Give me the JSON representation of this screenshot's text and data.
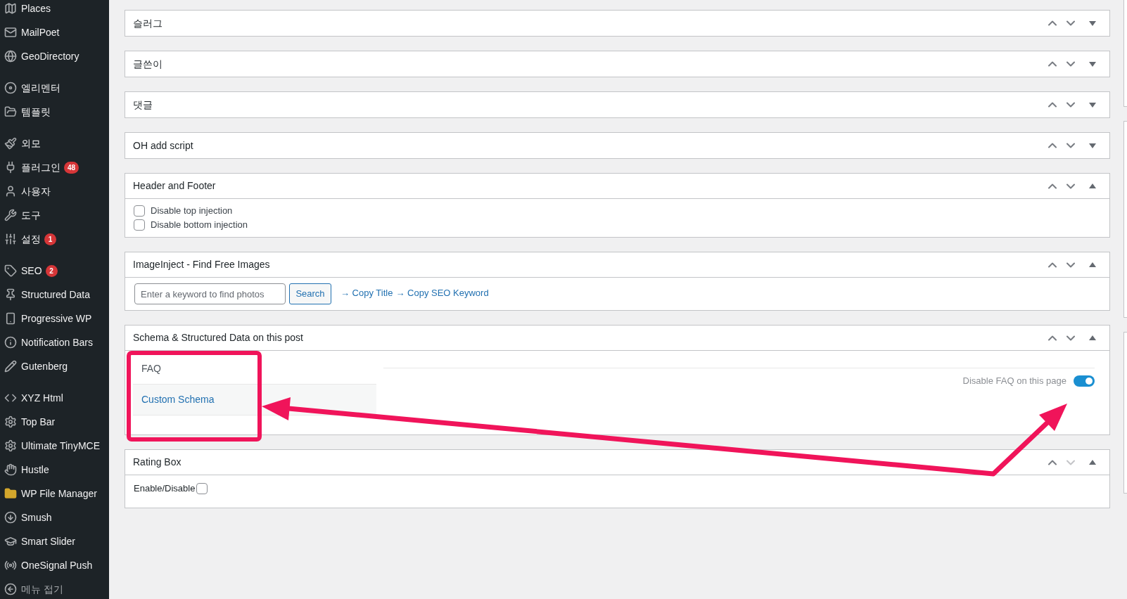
{
  "sidebar": {
    "groups": [
      {
        "items": [
          {
            "label": "Places"
          },
          {
            "label": "MailPoet"
          },
          {
            "label": "GeoDirectory"
          }
        ]
      },
      {
        "items": [
          {
            "label": "엘리멘터"
          },
          {
            "label": "템플릿"
          }
        ]
      },
      {
        "items": [
          {
            "label": "외모"
          },
          {
            "label": "플러그인",
            "badge": "48"
          },
          {
            "label": "사용자"
          },
          {
            "label": "도구"
          },
          {
            "label": "설정",
            "badge": "1"
          }
        ]
      },
      {
        "items": [
          {
            "label": "SEO",
            "badge": "2"
          },
          {
            "label": "Structured Data"
          },
          {
            "label": "Progressive WP"
          },
          {
            "label": "Notification Bars"
          },
          {
            "label": "Gutenberg"
          }
        ]
      },
      {
        "items": [
          {
            "label": "XYZ Html"
          },
          {
            "label": "Top Bar"
          },
          {
            "label": "Ultimate TinyMCE"
          },
          {
            "label": "Hustle"
          },
          {
            "label": "WP File Manager"
          },
          {
            "label": "Smush"
          },
          {
            "label": "Smart Slider"
          },
          {
            "label": "OneSignal Push"
          }
        ]
      }
    ],
    "collapse": {
      "label": "메뉴 접기"
    }
  },
  "panels": [
    {
      "title": "슬러그",
      "expanded": false,
      "move_down_disabled": false
    },
    {
      "title": "글쓴이",
      "expanded": false,
      "move_down_disabled": false
    },
    {
      "title": "댓글",
      "expanded": false,
      "move_down_disabled": false
    },
    {
      "title": "OH add script",
      "expanded": false,
      "move_down_disabled": false
    },
    {
      "title": "Header and Footer",
      "kind": "checkboxes",
      "expanded": true,
      "move_down_disabled": false,
      "checkboxes": [
        {
          "label": "Disable top injection",
          "checked": false
        },
        {
          "label": "Disable bottom injection",
          "checked": false
        }
      ]
    },
    {
      "title": "ImageInject - Find Free Images",
      "kind": "image_search",
      "expanded": true,
      "move_down_disabled": false,
      "search": {
        "placeholder": "Enter a keyword to find photos"
      },
      "button": "Search",
      "links": [
        "→ Copy Title",
        "→ Copy SEO Keyword"
      ]
    },
    {
      "title": "Schema & Structured Data on this post",
      "kind": "schema_tabs",
      "expanded": true,
      "move_down_disabled": false,
      "tabs": [
        {
          "label": "FAQ",
          "selected": true
        },
        {
          "label": "Custom Schema",
          "selected": false
        }
      ],
      "toggle": {
        "label": "Disable FAQ on this page",
        "on": true
      }
    },
    {
      "title": "Rating Box",
      "kind": "enable_checkbox",
      "expanded": true,
      "move_down_disabled": true,
      "checkbox": {
        "label": "Enable/Disable",
        "checked": false
      }
    }
  ]
}
